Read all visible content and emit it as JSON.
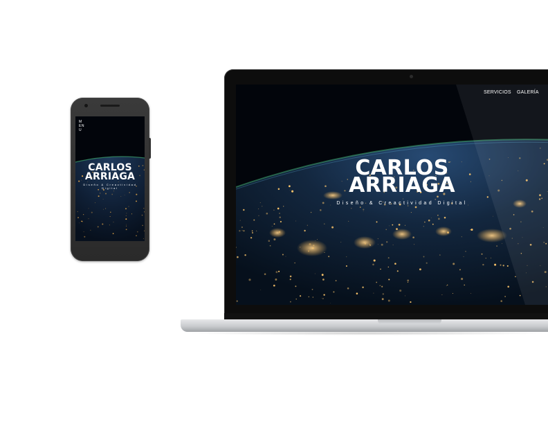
{
  "phone": {
    "menu_label": "MENU",
    "brand_line1": "CARLOS",
    "brand_line2": "ARRIAGA",
    "tagline": "Diseño & Creactividad Digital"
  },
  "laptop": {
    "nav": {
      "items": [
        {
          "label": "SERVICIOS"
        },
        {
          "label": "GALERÍA"
        }
      ]
    },
    "brand_line1": "CARLOS",
    "brand_line2": "ARRIAGA",
    "tagline": "Diseño & Creactividad Digital"
  },
  "colors": {
    "background": "#ffffff",
    "device_dark": "#2a2a2a",
    "screen_night": "#02050b",
    "city_lights": "#ffb84d",
    "atmosphere": "#3fa56f",
    "text": "#ffffff"
  }
}
